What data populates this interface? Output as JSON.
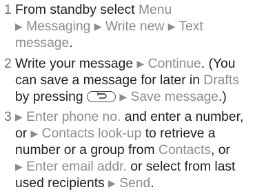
{
  "steps": [
    {
      "number": "1",
      "lines": [
        [
          {
            "t": "From standby select ",
            "h": false
          },
          {
            "t": "Menu",
            "h": true
          }
        ],
        [
          {
            "t": "Messaging",
            "h": true,
            "arrow": true
          },
          {
            "t": "Write new",
            "h": true,
            "arrow": true
          },
          {
            "t": "Text",
            "h": true,
            "arrow": true
          }
        ],
        [
          {
            "t": "message",
            "h": true
          },
          {
            "t": ".",
            "h": false
          }
        ]
      ]
    },
    {
      "number": "2",
      "lines": [
        [
          {
            "t": "Write your message ",
            "h": false
          },
          {
            "t": "Continue",
            "h": true,
            "arrow": true
          },
          {
            "t": ". (You",
            "h": false
          }
        ],
        [
          {
            "t": "can save a message for later in ",
            "h": false
          },
          {
            "t": "Drafts",
            "h": true
          }
        ],
        [
          {
            "t": "by pressing ",
            "h": false
          },
          {
            "key": "back"
          },
          {
            "t": "Save message",
            "h": true,
            "arrow": true
          },
          {
            "t": ".)",
            "h": false
          }
        ]
      ]
    },
    {
      "number": "3",
      "lines": [
        [
          {
            "t": "Enter phone no.",
            "h": true,
            "arrow": true
          },
          {
            "t": " and enter a number,",
            "h": false
          }
        ],
        [
          {
            "t": "or ",
            "h": false
          },
          {
            "t": "Contacts look-up",
            "h": true,
            "arrow": true
          },
          {
            "t": " to retrieve a",
            "h": false
          }
        ],
        [
          {
            "t": "number or a group from ",
            "h": false
          },
          {
            "t": "Contacts",
            "h": true
          },
          {
            "t": ", or",
            "h": false
          }
        ],
        [
          {
            "t": "Enter email addr.",
            "h": true,
            "arrow": true
          },
          {
            "t": " or select from last",
            "h": false
          }
        ],
        [
          {
            "t": "used recipients ",
            "h": false
          },
          {
            "t": "Send",
            "h": true,
            "arrow": true
          },
          {
            "t": ".",
            "h": false
          }
        ]
      ]
    }
  ],
  "icons": {
    "arrow": "arrow-right-icon",
    "key": "back-key-icon"
  }
}
